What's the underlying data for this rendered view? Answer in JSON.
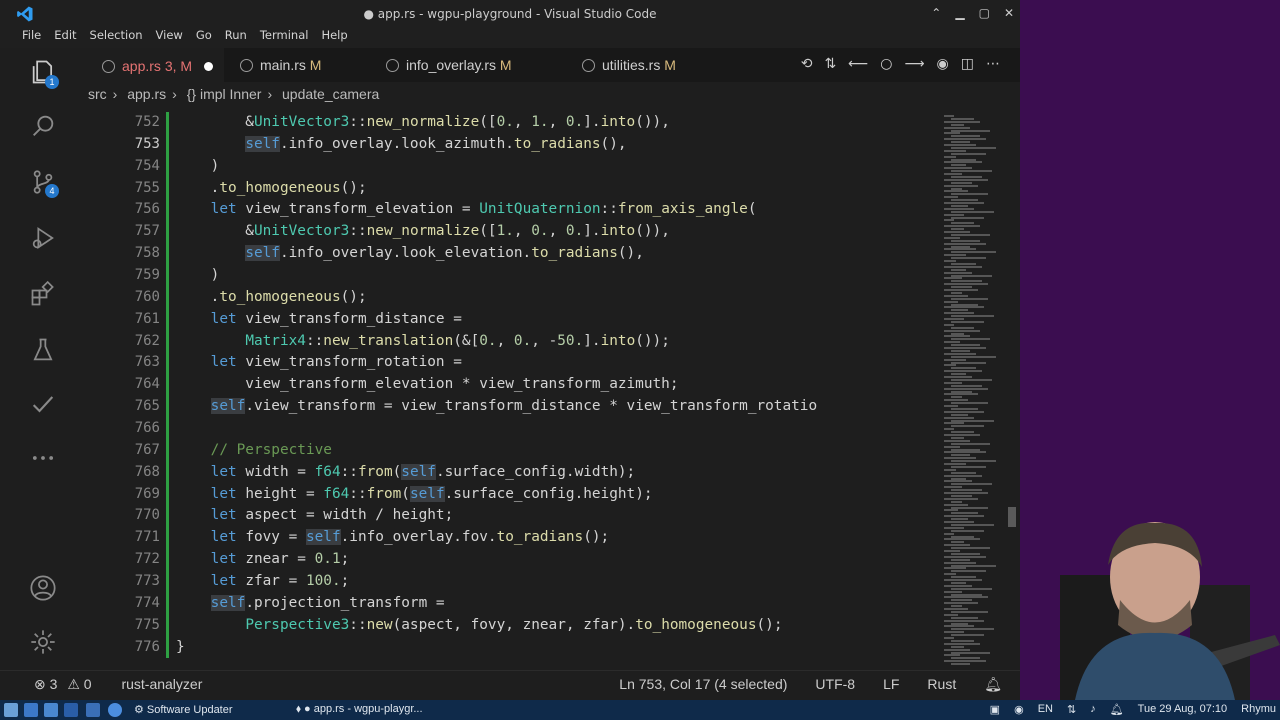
{
  "window": {
    "title": "● app.rs - wgpu-playground - Visual Studio Code"
  },
  "menu": [
    "File",
    "Edit",
    "Selection",
    "View",
    "Go",
    "Run",
    "Terminal",
    "Help"
  ],
  "activity": {
    "explorer_badge": "1",
    "scm_badge": "4"
  },
  "tabs": [
    {
      "label": "app.rs",
      "suffix": "3, M",
      "modified": true
    },
    {
      "label": "main.rs",
      "suffix": "M"
    },
    {
      "label": "info_overlay.rs",
      "suffix": "M"
    },
    {
      "label": "utilities.rs",
      "suffix": "M"
    }
  ],
  "breadcrumb": {
    "folder": "src",
    "file": "app.rs",
    "impl": "{} impl Inner",
    "method": "update_camera"
  },
  "line_numbers": [
    "752",
    "753",
    "754",
    "755",
    "756",
    "757",
    "758",
    "759",
    "760",
    "761",
    "762",
    "763",
    "764",
    "765",
    "766",
    "767",
    "768",
    "769",
    "770",
    "771",
    "772",
    "773",
    "774",
    "775",
    "776"
  ],
  "code_lines": [
    "        &UnitVector3::new_normalize([0., 1., 0.].into()),",
    "        self.info_overlay.look_azimuth.to_radians(),",
    "    )",
    "    .to_homogeneous();",
    "    let view_transform_elevation = UnitQuaternion::from_axis_angle(",
    "        &UnitVector3::new_normalize([1., 0., 0.].into()),",
    "        self.info_overlay.look_elevation.to_radians(),",
    "    )",
    "    .to_homogeneous();",
    "    let view_transform_distance =",
    "        Matrix4::new_translation(&[0., 0., -50.].into());",
    "    let view_transform_rotation =",
    "        view_transform_elevation * view_transform_azimuth;",
    "    self.view_transform = view_transform_distance * view_transform_rotatio",
    "",
    "    // Perspective",
    "    let width = f64::from(self.surface_config.width);",
    "    let height = f64::from(self.surface_config.height);",
    "    let aspect = width / height;",
    "    let fovy = self.info_overlay.fov.to_radians();",
    "    let znear = 0.1;",
    "    let zfar = 100.;",
    "    self.projection_transform =",
    "        Perspective3::new(aspect, fovy, znear, zfar).to_homogeneous();",
    "}"
  ],
  "status": {
    "errors": "3",
    "warnings": "0",
    "language_server": "rust-analyzer",
    "position": "Ln 753, Col 17 (4 selected)",
    "encoding": "UTF-8",
    "eol": "LF",
    "language": "Rust"
  },
  "taskbar": {
    "tasks": [
      "Software Updater",
      "app.rs - wgpu-playgr..."
    ],
    "lang": "EN",
    "clock": "Tue 29 Aug, 07:10",
    "user": "Rhymu"
  },
  "colors": {
    "keyword": "#569cd6",
    "type": "#4ec9b0",
    "function": "#dcdcaa",
    "number": "#b5cea8",
    "comment": "#6a9955",
    "modified": "#d7ba7d",
    "accent": "#2478cc"
  }
}
